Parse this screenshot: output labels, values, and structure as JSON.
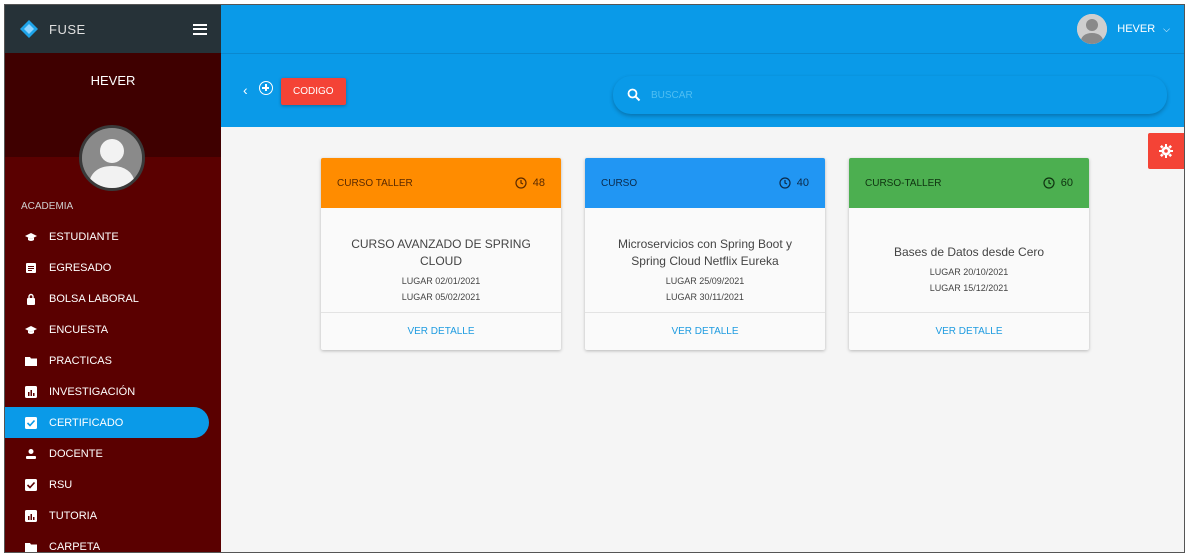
{
  "app": {
    "name": "FUSE"
  },
  "sidebar": {
    "user_name": "HEVER",
    "section_label": "ACADEMIA",
    "items": [
      {
        "label": "ESTUDIANTE",
        "icon": "graduation-cap-icon"
      },
      {
        "label": "EGRESADO",
        "icon": "document-icon"
      },
      {
        "label": "BOLSA LABORAL",
        "icon": "lock-icon"
      },
      {
        "label": "ENCUESTA",
        "icon": "graduation-cap-icon"
      },
      {
        "label": "PRACTICAS",
        "icon": "folder-icon"
      },
      {
        "label": "INVESTIGACIÓN",
        "icon": "chart-icon"
      },
      {
        "label": "CERTIFICADO",
        "icon": "checkbox-icon",
        "active": true
      },
      {
        "label": "DOCENTE",
        "icon": "person-icon"
      },
      {
        "label": "RSU",
        "icon": "checkbox-icon"
      },
      {
        "label": "TUTORIA",
        "icon": "chart-icon"
      },
      {
        "label": "CARPETA",
        "icon": "folder-icon"
      }
    ]
  },
  "header": {
    "user_name": "HEVER"
  },
  "toolbar": {
    "code_button": "CODIGO",
    "search_placeholder": "BUSCAR"
  },
  "colors": {
    "primary": "#0a9ae8",
    "sidebar": "#5a0000",
    "accent": "#f44336",
    "card_orange": "#ff8c00",
    "card_blue": "#2196f3",
    "card_green": "#4caf50"
  },
  "cards": [
    {
      "type": "CURSO TALLER",
      "hours": "48",
      "title": "CURSO AVANZADO DE SPRING CLOUD",
      "date1": "LUGAR 02/01/2021",
      "date2": "LUGAR 05/02/2021",
      "action": "VER DETALLE"
    },
    {
      "type": "CURSO",
      "hours": "40",
      "title": "Microservicios con Spring Boot y Spring Cloud Netflix Eureka",
      "date1": "LUGAR 25/09/2021",
      "date2": "LUGAR 30/11/2021",
      "action": "VER DETALLE"
    },
    {
      "type": "CURSO-TALLER",
      "hours": "60",
      "title": "Bases de Datos desde Cero",
      "date1": "LUGAR 20/10/2021",
      "date2": "LUGAR 15/12/2021",
      "action": "VER DETALLE"
    }
  ]
}
